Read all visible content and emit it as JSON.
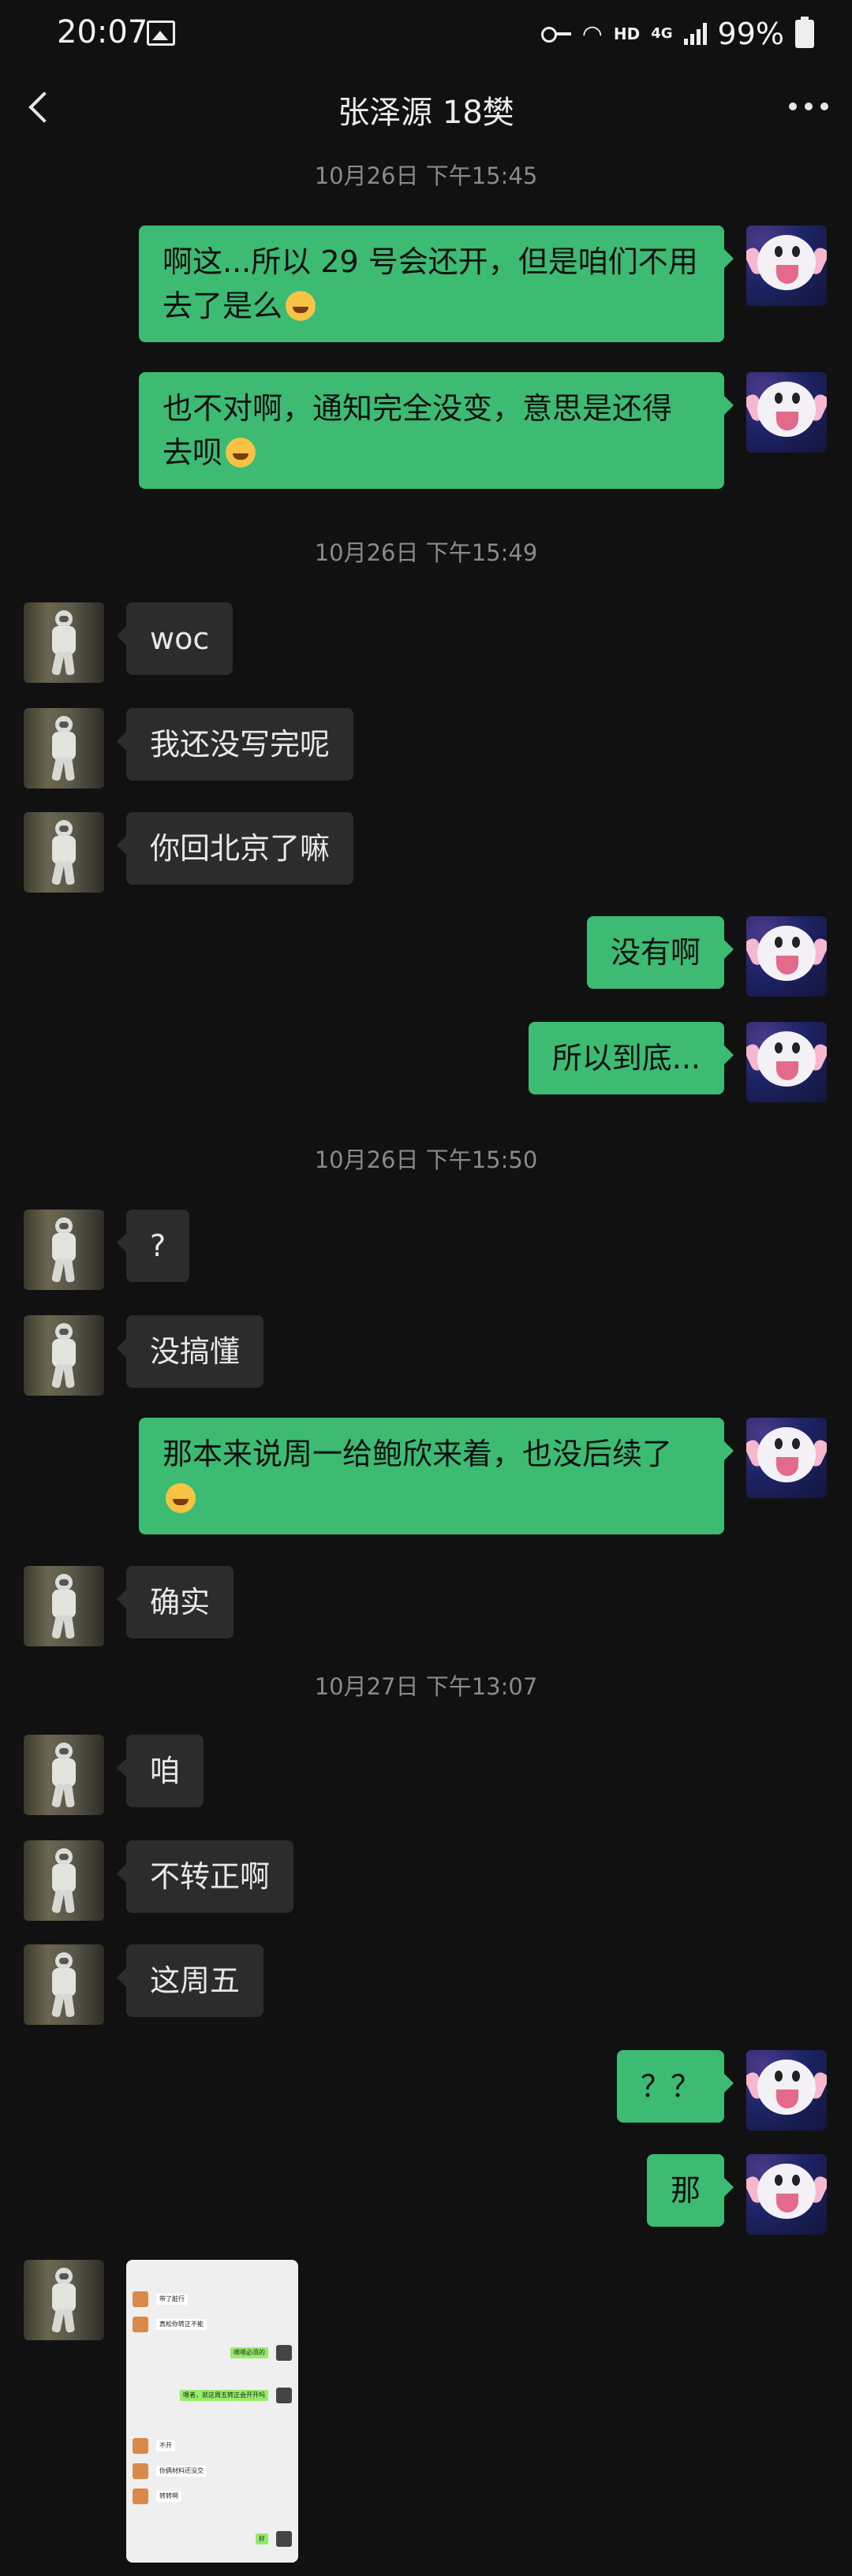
{
  "status_bar": {
    "time": "20:07",
    "hd": "HD",
    "network": "4G",
    "battery": "99%"
  },
  "header": {
    "title": "张泽源 18樊"
  },
  "timestamps": [
    "10月26日 下午15:45",
    "10月26日 下午15:49",
    "10月26日 下午15:50",
    "10月27日 下午13:07"
  ],
  "messages": [
    {
      "from": "me",
      "text": "啊这...所以 29 号会还开，但是咱们不用去了是么",
      "emoji": "joy"
    },
    {
      "from": "me",
      "text": "也不对啊，通知完全没变，意思是还得去呗",
      "emoji": "rofl"
    },
    {
      "from": "other",
      "text": "woc"
    },
    {
      "from": "other",
      "text": "我还没写完呢"
    },
    {
      "from": "other",
      "text": "你回北京了嘛"
    },
    {
      "from": "me",
      "text": "没有啊"
    },
    {
      "from": "me",
      "text": "所以到底..."
    },
    {
      "from": "other",
      "text": "?"
    },
    {
      "from": "other",
      "text": "没搞懂"
    },
    {
      "from": "me",
      "text": "那本来说周一给鲍欣来着，也没后续了",
      "emoji": "joy"
    },
    {
      "from": "other",
      "text": "确实"
    },
    {
      "from": "other",
      "text": "咱"
    },
    {
      "from": "other",
      "text": "不转正啊"
    },
    {
      "from": "other",
      "text": "这周五"
    },
    {
      "from": "me",
      "text": "？？"
    },
    {
      "from": "me",
      "text": "那"
    },
    {
      "from": "other",
      "type": "image"
    }
  ],
  "image_preview": {
    "rows": [
      "带了脏行",
      "真松你转正不能",
      "嗯嗯必须的",
      "嗯者，就这周五转正会开开吗",
      "不开",
      "你俩材料还没交",
      "转转啊",
      "好"
    ]
  },
  "icons": {
    "back": "chevron-left-icon",
    "more": "more-dots-icon",
    "gallery": "gallery-icon",
    "key": "key-icon",
    "wifi": "wifi-icon",
    "signal": "signal-icon",
    "battery": "battery-icon"
  },
  "colors": {
    "background": "#111111",
    "bubble_me": "#3dbb72",
    "bubble_other": "#2c2c2c"
  }
}
